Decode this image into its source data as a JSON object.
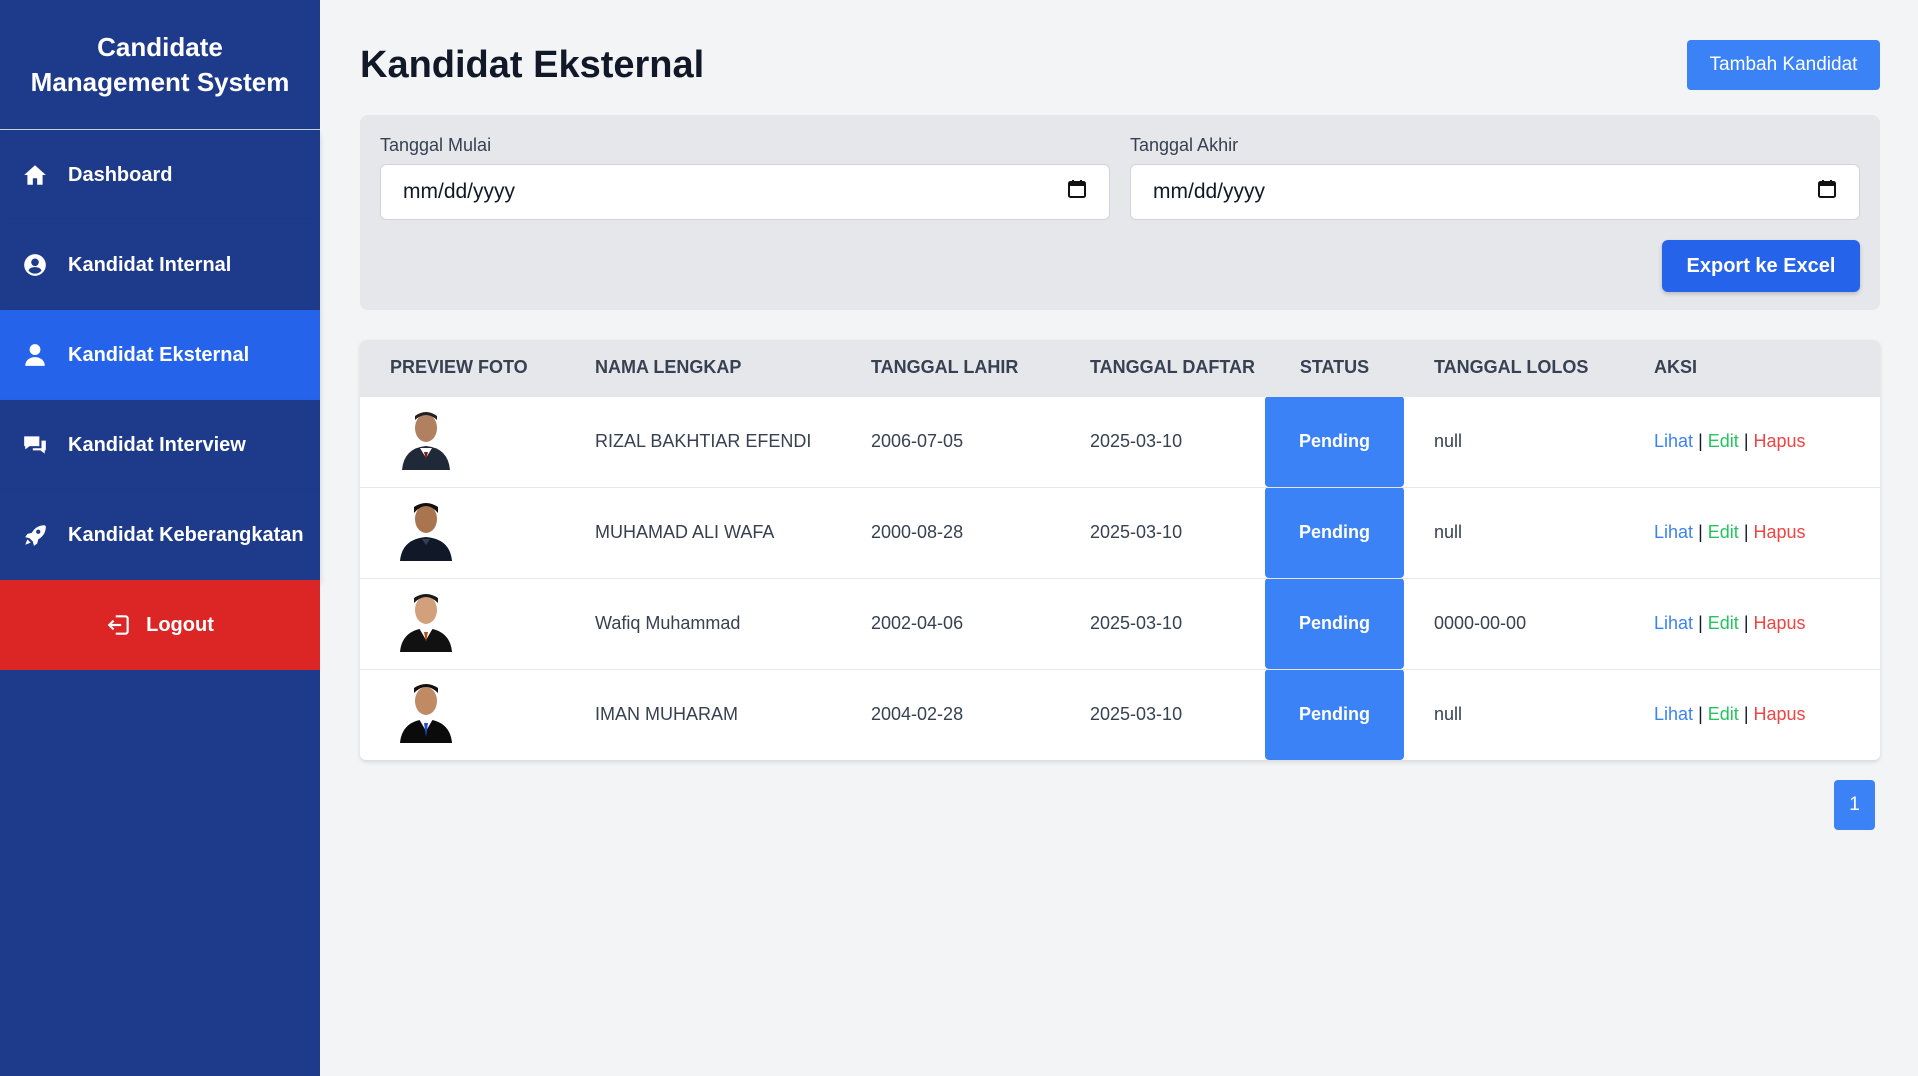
{
  "sidebar": {
    "brand": "Candidate Management System",
    "items": [
      {
        "label": "Dashboard",
        "icon": "home-icon"
      },
      {
        "label": "Kandidat Internal",
        "icon": "user-circle-icon"
      },
      {
        "label": "Kandidat Eksternal",
        "icon": "user-icon"
      },
      {
        "label": "Kandidat Interview",
        "icon": "comments-icon"
      },
      {
        "label": "Kandidat Keberangkatan",
        "icon": "rocket-icon"
      }
    ],
    "active_index": 2,
    "logout_label": "Logout"
  },
  "header": {
    "title": "Kandidat Eksternal",
    "add_button": "Tambah Kandidat"
  },
  "filter": {
    "start_label": "Tanggal Mulai",
    "start_value": "mm/dd/yyyy",
    "end_label": "Tanggal Akhir",
    "end_value": "mm/dd/yyyy",
    "export_button": "Export ke Excel"
  },
  "table": {
    "headers": [
      "PREVIEW FOTO",
      "NAMA LENGKAP",
      "TANGGAL LAHIR",
      "TANGGAL DAFTAR",
      "STATUS",
      "TANGGAL LOLOS",
      "AKSI"
    ],
    "rows": [
      {
        "nama": "RIZAL BAKHTIAR EFENDI",
        "lahir": "2006-07-05",
        "daftar": "2025-03-10",
        "status": "Pending",
        "lolos": "null"
      },
      {
        "nama": "MUHAMAD ALI WAFA",
        "lahir": "2000-08-28",
        "daftar": "2025-03-10",
        "status": "Pending",
        "lolos": "null"
      },
      {
        "nama": "Wafiq Muhammad",
        "lahir": "2002-04-06",
        "daftar": "2025-03-10",
        "status": "Pending",
        "lolos": "0000-00-00"
      },
      {
        "nama": "IMAN MUHARAM",
        "lahir": "2004-02-28",
        "daftar": "2025-03-10",
        "status": "Pending",
        "lolos": "null"
      }
    ],
    "actions": {
      "view": "Lihat",
      "edit": "Edit",
      "delete": "Hapus",
      "separator": "|"
    }
  },
  "pagination": {
    "current": "1"
  },
  "colors": {
    "sidebar": "#1e3a8a",
    "active": "#2563eb",
    "logout": "#dc2626",
    "primary": "#3b82f6",
    "edit": "#22c55e",
    "delete": "#ef4444"
  }
}
